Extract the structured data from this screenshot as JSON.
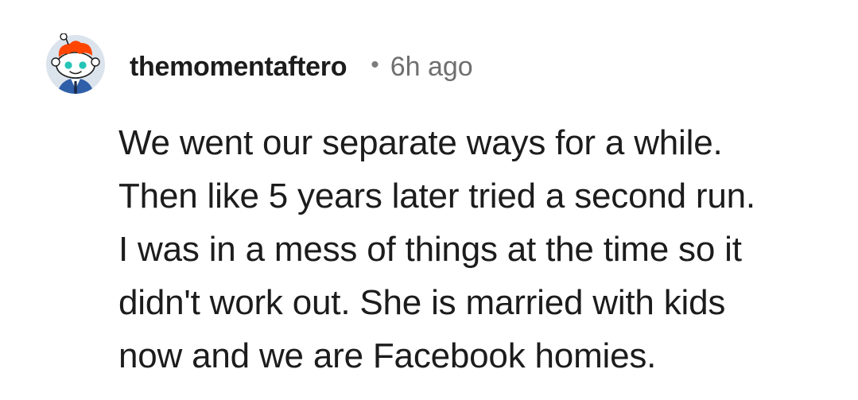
{
  "comment": {
    "author": {
      "username": "themomentaftero",
      "avatar_icon": "snoo-avatar-icon"
    },
    "separator": "•",
    "timestamp": "6h ago",
    "body_lines": [
      "We went our separate ways for a while.",
      "Then like 5 years later tried a second run.",
      "I was in a mess of things at the time so it",
      "didn't work out. She is married with kids",
      "now and we are Facebook homies."
    ]
  },
  "colors": {
    "background": "#ffffff",
    "text": "#1c1c1c",
    "muted": "#6f6f6f",
    "avatar_bg": "#dbe3ec",
    "snoo_hair": "#ff4500",
    "snoo_eyes": "#24c4b6",
    "snoo_suit": "#2f5fa8"
  }
}
